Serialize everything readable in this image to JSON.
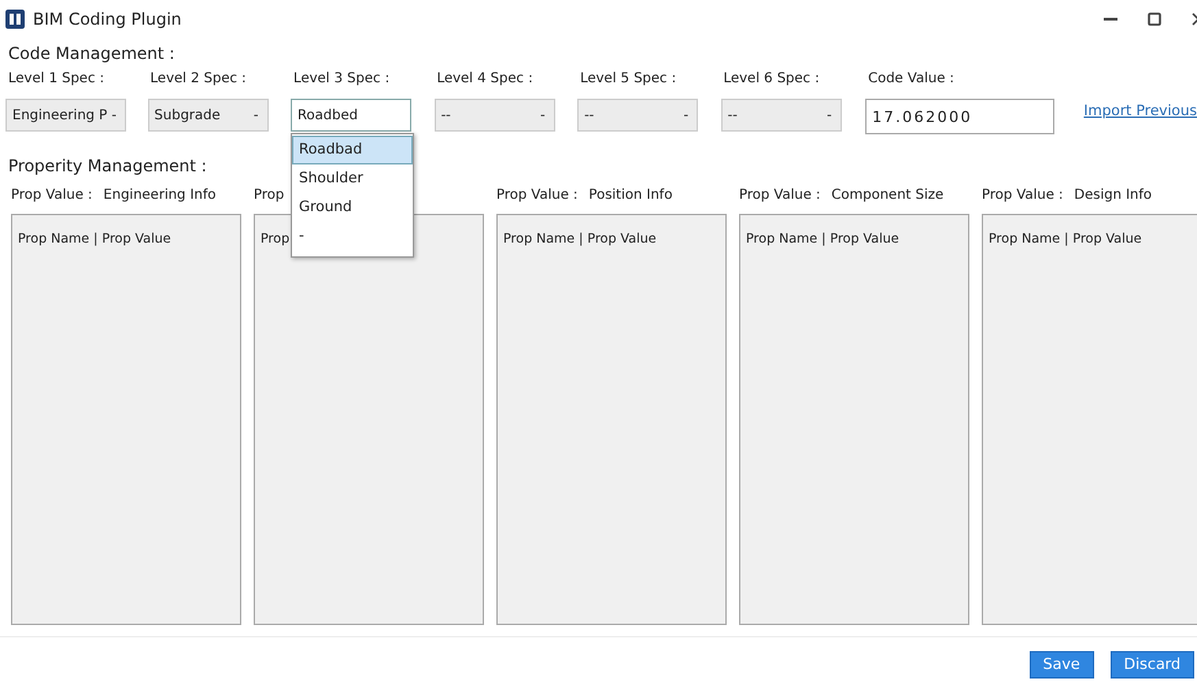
{
  "window": {
    "title": "BIM Coding Plugin"
  },
  "code_management": {
    "heading": "Code Management :",
    "specs": [
      {
        "label": "Level 1 Spec :",
        "value": "Engineering P",
        "arrow": "-",
        "open": false
      },
      {
        "label": "Level 2 Spec :",
        "value": "Subgrade",
        "arrow": "-",
        "open": false
      },
      {
        "label": "Level 3 Spec :",
        "value": "Roadbed",
        "open": true
      },
      {
        "label": "Level 4 Spec :",
        "value": "--",
        "arrow": "-",
        "open": false
      },
      {
        "label": "Level 5 Spec :",
        "value": "--",
        "arrow": "-",
        "open": false
      },
      {
        "label": "Level 6 Spec :",
        "value": "--",
        "arrow": "-",
        "open": false
      }
    ],
    "code_value": {
      "label": "Code Value :",
      "value": "17.062000"
    },
    "import_link": "Import Previous"
  },
  "dropdown": {
    "options": [
      {
        "label": "Roadbad",
        "selected": true
      },
      {
        "label": "Shoulder",
        "selected": false
      },
      {
        "label": "Ground",
        "selected": false
      },
      {
        "label": "-",
        "selected": false
      }
    ]
  },
  "property_management": {
    "heading": "Properity Management :",
    "panels": [
      {
        "label": "Prop Value :",
        "title": "Engineering Info",
        "header": "Prop Name | Prop Value"
      },
      {
        "label": "Prop",
        "header": "Prop"
      },
      {
        "label": "Prop Value :",
        "title": "Position Info",
        "header": "Prop Name | Prop Value"
      },
      {
        "label": "Prop Value :",
        "title": "Component Size",
        "header": "Prop Name | Prop Value"
      },
      {
        "label": "Prop Value :",
        "title": "Design Info",
        "header": "Prop Name | Prop Value"
      }
    ]
  },
  "buttons": [
    {
      "label": "Save"
    },
    {
      "label": "Discard"
    }
  ]
}
